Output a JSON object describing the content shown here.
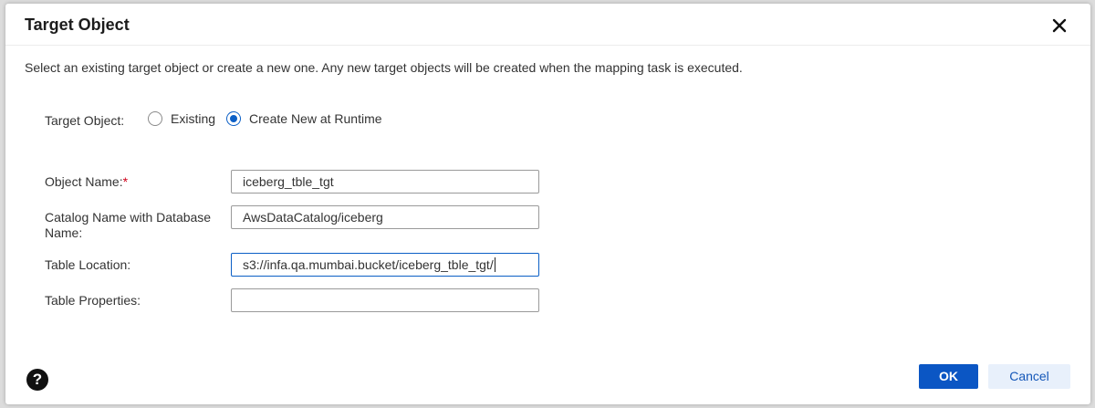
{
  "dialog": {
    "title": "Target Object",
    "description": "Select an existing target object or create a new one. Any new target objects will be created when the mapping task is executed."
  },
  "target_object": {
    "label": "Target Object:",
    "options": [
      {
        "label": "Existing",
        "selected": false
      },
      {
        "label": "Create New at Runtime",
        "selected": true
      }
    ]
  },
  "fields": {
    "object_name": {
      "label": "Object Name:",
      "required_mark": "*",
      "value": "iceberg_tble_tgt"
    },
    "catalog_name": {
      "label_line1": "Catalog Name with Database",
      "label_line2": "Name:",
      "value": "AwsDataCatalog/iceberg"
    },
    "table_location": {
      "label": "Table Location:",
      "value": "s3://infa.qa.mumbai.bucket/iceberg_tble_tgt/"
    },
    "table_properties": {
      "label": "Table Properties:",
      "value": ""
    }
  },
  "footer": {
    "ok_label": "OK",
    "cancel_label": "Cancel",
    "help_glyph": "?"
  },
  "icons": {
    "close": "close-icon",
    "help": "help-icon"
  },
  "colors": {
    "primary": "#0b56c4",
    "radio_selected": "#0b5fc6",
    "required": "#d0021b",
    "cancel_bg": "#e8f0fb"
  }
}
